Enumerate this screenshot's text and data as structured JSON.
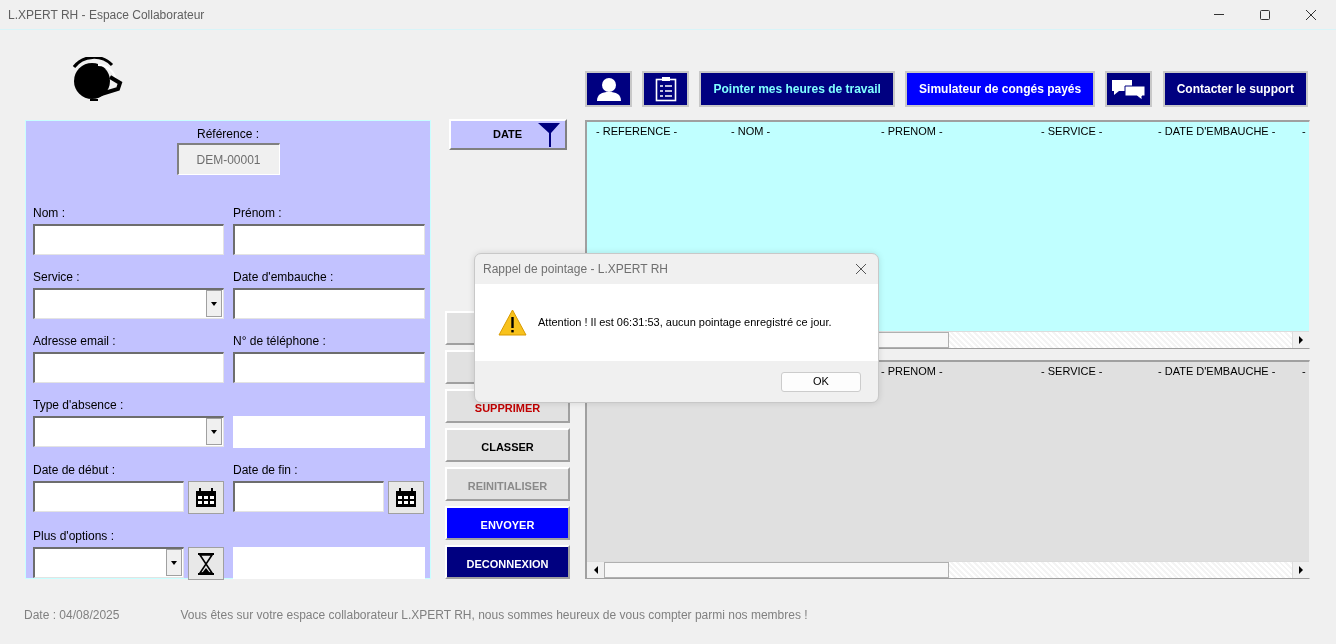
{
  "window": {
    "title": "L.XPERT RH - Espace Collaborateur"
  },
  "form": {
    "reference": {
      "label": "Référence :",
      "value": "DEM-00001"
    },
    "fields": [
      {
        "label": "Nom :",
        "kind": "text"
      },
      {
        "label": "Prénom :",
        "kind": "text"
      },
      {
        "label": "Service :",
        "kind": "select"
      },
      {
        "label": "Date d'embauche :",
        "kind": "text"
      },
      {
        "label": "Adresse email :",
        "kind": "text"
      },
      {
        "label": "N° de téléphone :",
        "kind": "text"
      },
      {
        "label": "Type d'absence :",
        "kind": "select"
      },
      {
        "kind": "plain"
      },
      {
        "label": "Date de début :",
        "kind": "date"
      },
      {
        "label": "Date de fin :",
        "kind": "date"
      },
      {
        "label": "Plus d'options :",
        "kind": "timer"
      },
      {
        "kind": "plain"
      }
    ]
  },
  "sort_button": {
    "label": "DATE"
  },
  "actions": [
    {
      "kind": "default"
    },
    {
      "kind": "default"
    },
    {
      "label": "SUPPRIMER",
      "kind": "danger"
    },
    {
      "label": "CLASSER",
      "kind": "default"
    },
    {
      "label": "REINITIALISER",
      "kind": "greyed"
    },
    {
      "label": "ENVOYER",
      "kind": "primary"
    },
    {
      "label": "DECONNEXION",
      "kind": "dark"
    }
  ],
  "toolbar": [
    {
      "kind": "profile"
    },
    {
      "kind": "checklist"
    },
    {
      "kind": "text",
      "label": "Pointer mes heures de travail",
      "selected": true,
      "hovered": false
    },
    {
      "kind": "text",
      "label": "Simulateur de congés payés",
      "selected": false,
      "hovered": true
    },
    {
      "kind": "chat"
    },
    {
      "kind": "text",
      "label": "Contacter le support",
      "selected": false,
      "hovered": false
    }
  ],
  "tables": [
    {
      "kind": "active",
      "columns": [
        "- REFERENCE -",
        "- NOM -",
        "- PRENOM -",
        "- SERVICE -",
        "- DATE D'EMBAUCHE -",
        "-"
      ]
    },
    {
      "kind": "archive",
      "columns": [
        "- PRENOM -",
        "- SERVICE -",
        "- DATE D'EMBAUCHE -",
        "-"
      ]
    }
  ],
  "dialog": {
    "title": "Rappel de pointage - L.XPERT RH",
    "message": "Attention ! Il est 06:31:53, aucun pointage enregistré ce jour.",
    "button": "OK"
  },
  "status_bar": {
    "date": "Date : 04/08/2025",
    "message": "Vous êtes sur votre espace collaborateur L.XPERT RH, nous sommes heureux de vous compter parmi nos membres !"
  }
}
